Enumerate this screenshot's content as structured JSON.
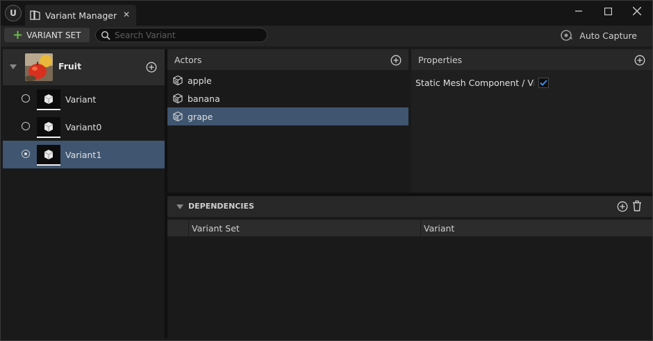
{
  "app": {
    "logo": "ue-logo"
  },
  "tab": {
    "title": "Variant Manager",
    "icon": "variant-manager-icon",
    "close": "✕"
  },
  "window_controls": {
    "minimize": "—",
    "maximize": "☐",
    "close": "✕"
  },
  "toolbar": {
    "add_variant_set_label": "VARIANT SET",
    "search_placeholder": "Search Variant",
    "auto_capture_label": "Auto Capture"
  },
  "variant_sets": [
    {
      "name": "Fruit",
      "variants": [
        {
          "label": "Variant",
          "active": false
        },
        {
          "label": "Variant0",
          "active": false
        },
        {
          "label": "Variant1",
          "active": true
        }
      ]
    }
  ],
  "actors": {
    "title": "Actors",
    "items": [
      {
        "name": "apple",
        "selected": false
      },
      {
        "name": "banana",
        "selected": false
      },
      {
        "name": "grape",
        "selected": true
      }
    ]
  },
  "properties": {
    "title": "Properties",
    "items": [
      {
        "label": "Static Mesh Component / Visib",
        "checked": true
      }
    ]
  },
  "dependencies": {
    "title": "DEPENDENCIES",
    "columns": [
      "Variant Set",
      "Variant"
    ]
  },
  "colors": {
    "selection": "#3f5570",
    "accent_green": "#6cb84a",
    "checkbox_blue": "#3d8cf0"
  }
}
